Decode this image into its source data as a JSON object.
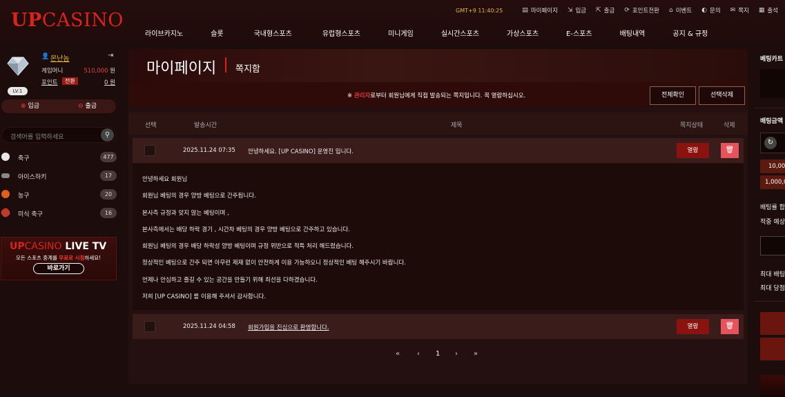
{
  "logo": {
    "up": "UP",
    "casino": "CASINO"
  },
  "topbar": {
    "clock": "GMT+9 11:40:25",
    "links": [
      "마이페이지",
      "입금",
      "출금",
      "포인트전환",
      "이벤트",
      "문의",
      "쪽지",
      "출석"
    ]
  },
  "nav": [
    "라이브카지노",
    "슬롯",
    "국내형스포츠",
    "유럽형스포츠",
    "미니게임",
    "실시간스포츠",
    "가상스포츠",
    "E-스포츠",
    "배팅내역",
    "공지 & 규정"
  ],
  "profile": {
    "username": "몬난놈",
    "level": "LV.1",
    "game_money_label": "게임머니",
    "game_money": "510,000",
    "won": "원",
    "point_label": "포인트",
    "convert_label": "전환",
    "point": "0"
  },
  "deposit_label": "입금",
  "withdraw_label": "출금",
  "search": {
    "placeholder": "검색어를 입력하세요"
  },
  "sports": [
    {
      "name": "축구",
      "count": "477",
      "icon": "soccer-ball-icon",
      "color": "#e8e8e8"
    },
    {
      "name": "아이스하키",
      "count": "17",
      "icon": "hockey-puck-icon",
      "color": "#888888"
    },
    {
      "name": "농구",
      "count": "20",
      "icon": "basketball-icon",
      "color": "#e0601a"
    },
    {
      "name": "미식 축구",
      "count": "16",
      "icon": "american-football-icon",
      "color": "#c0392b"
    }
  ],
  "banner": {
    "title_up": "UP",
    "title_casino": "CASINO",
    "title_tv": "LIVE TV",
    "sub_pre": "모든 스포츠 중계를 ",
    "sub_red": "무료로 시청",
    "sub_post": "하세요!",
    "button": "바로가기"
  },
  "page": {
    "title": "마이페이지",
    "subtitle": "쪽지함",
    "notice_star": "※ ",
    "notice_admin": "관리자",
    "notice_rest": "로부터 회원님에게 직접 발송되는 쪽지입니다. 꼭 열람하십시오.",
    "btn_check_all": "전체확인",
    "btn_delete_selected": "선택삭제"
  },
  "table": {
    "headers": {
      "select": "선택",
      "time": "발송시간",
      "title": "제목",
      "status": "쪽지상태",
      "delete": "삭제"
    },
    "rows": [
      {
        "date": "2025.11.24 07:35",
        "title": "안녕하세요. [UP CASINO] 운영진 입니다.",
        "status": "열람"
      },
      {
        "date": "2025.11.24 04:58",
        "title": "회원가입을 진심으로 환영합니다.",
        "status": "열람"
      }
    ],
    "delete_glyph": "🗑"
  },
  "message_body": [
    "안녕하세요 회원님",
    "회원님 베팅의 경우 양방 베팅으로 간주됩니다.",
    "본사측 규정과 맞지 않는 베팅이며 ,",
    "본사측에서는 배당 하락 경기 , 시간차 베팅의 경우 양방 베팅으로 간주하고 있습니다.",
    "회원님 베팅의 경우 배당 하락성 양방 베팅이며 규정 위반으로 적특 처리 해드렸습니다.",
    "정상적인 베팅으로 간주 되면 아무런 제재 없이 안전하게 이용 가능하오니 정상적인 베팅 해주시기 바랍니다.",
    "언제나 안심하고 즐길 수 있는 공간을 만들기 위해 최선을 다하겠습니다.",
    "저희 [UP CASINO] 를 이용해 주셔서 감사합니다."
  ],
  "pagination": {
    "first": "«",
    "prev": "‹",
    "current": "1",
    "next": "›",
    "last": "»"
  },
  "right_panel": {
    "betslip": "베팅카트",
    "bet_amount": "배팅금액",
    "amt1": "10,00",
    "amt2": "1,000,0",
    "total_odds": "배팅률 합",
    "expected": "적중 예상",
    "max_bet": "최대 배팅",
    "max_win": "최대 당첨"
  },
  "colors": {
    "accent": "#d8241c",
    "gold": "#e7b83a",
    "danger": "#e5545c"
  }
}
